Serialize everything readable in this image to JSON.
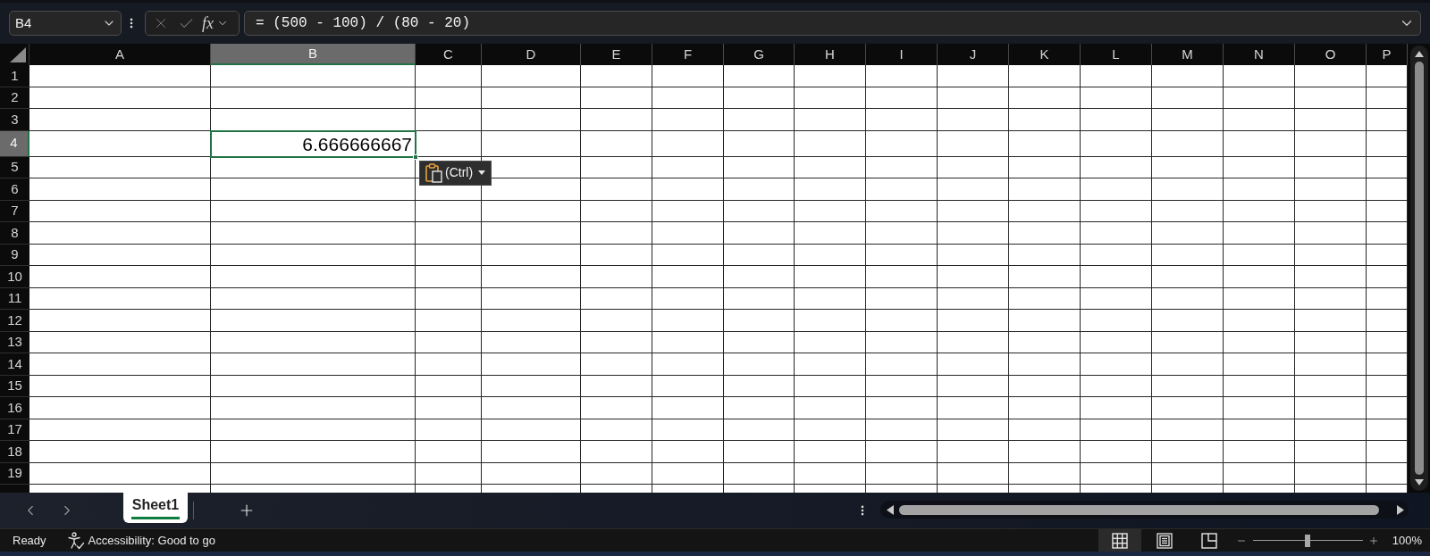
{
  "formula_bar": {
    "name_box": "B4",
    "edit_buttons": [
      {
        "kind": "cancel",
        "disabled": true
      },
      {
        "kind": "enter",
        "disabled": true
      }
    ],
    "function_label": "fx",
    "formula": "= (500 - 100) / (80 - 20)"
  },
  "grid": {
    "columns": [
      {
        "label": "A",
        "selected": false
      },
      {
        "label": "B",
        "selected": true
      },
      {
        "label": "C",
        "selected": false
      },
      {
        "label": "D",
        "selected": false
      },
      {
        "label": "E",
        "selected": false
      },
      {
        "label": "F",
        "selected": false
      },
      {
        "label": "G",
        "selected": false
      },
      {
        "label": "H",
        "selected": false
      },
      {
        "label": "I",
        "selected": false
      },
      {
        "label": "J",
        "selected": false
      },
      {
        "label": "K",
        "selected": false
      },
      {
        "label": "L",
        "selected": false
      },
      {
        "label": "M",
        "selected": false
      },
      {
        "label": "N",
        "selected": false
      },
      {
        "label": "O",
        "selected": false
      },
      {
        "label": "P",
        "selected": false
      }
    ],
    "rows": [
      {
        "label": "1",
        "selected": false
      },
      {
        "label": "2",
        "selected": false
      },
      {
        "label": "3",
        "selected": false
      },
      {
        "label": "4",
        "selected": true
      },
      {
        "label": "5",
        "selected": false
      },
      {
        "label": "6",
        "selected": false
      },
      {
        "label": "7",
        "selected": false
      },
      {
        "label": "8",
        "selected": false
      },
      {
        "label": "9",
        "selected": false
      },
      {
        "label": "10",
        "selected": false
      },
      {
        "label": "11",
        "selected": false
      },
      {
        "label": "12",
        "selected": false
      },
      {
        "label": "13",
        "selected": false
      },
      {
        "label": "14",
        "selected": false
      },
      {
        "label": "15",
        "selected": false
      },
      {
        "label": "16",
        "selected": false
      },
      {
        "label": "17",
        "selected": false
      },
      {
        "label": "18",
        "selected": false
      },
      {
        "label": "19",
        "selected": false
      }
    ],
    "active_cell": {
      "value": "6.666666667"
    },
    "paste_options": {
      "label": "(Ctrl)"
    }
  },
  "sheet_tabs": [
    {
      "label": "Sheet1",
      "selected": true
    }
  ],
  "status_bar": {
    "mode": "Ready",
    "accessibility": "Accessibility: Good to go",
    "views": [
      {
        "kind": "normal",
        "selected": true
      },
      {
        "kind": "page_layout",
        "selected": false
      },
      {
        "kind": "page_break_preview",
        "selected": false
      }
    ],
    "zoom": {
      "level": 0.5,
      "reading": "100%"
    }
  }
}
